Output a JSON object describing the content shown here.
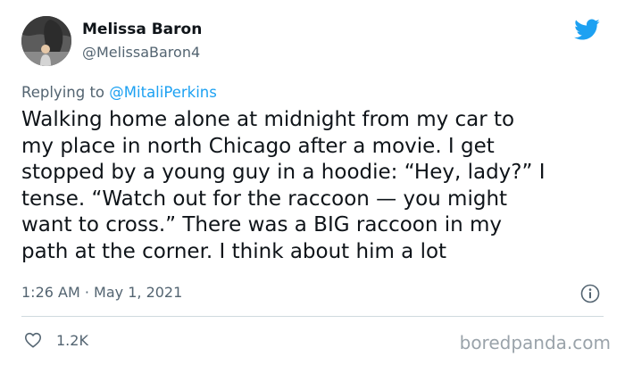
{
  "author": {
    "display_name": "Melissa Baron",
    "handle": "@MelissaBaron4"
  },
  "icons": {
    "brand": "twitter-bird-icon",
    "info": "info-icon",
    "like": "heart-icon"
  },
  "reply": {
    "prefix": "Replying to",
    "mention": "@MitaliPerkins"
  },
  "tweet": {
    "lines": [
      "Walking home alone at midnight from my car to",
      "my place in north Chicago after a movie. I get",
      "stopped by a young guy in a hoodie: “Hey, lady?” I",
      "tense. “Watch out for the raccoon — you might",
      "want to cross.” There was a BIG raccoon in my",
      "path at the corner. I think about him a lot"
    ]
  },
  "meta": {
    "time": "1:26 AM",
    "separator": "·",
    "date": "May 1, 2021"
  },
  "stats": {
    "likes": "1.2K"
  },
  "watermark": "boredpanda.com",
  "colors": {
    "brand_blue": "#1da1f2",
    "text": "#0f1419",
    "muted": "#536471",
    "divider": "#cfd9de"
  }
}
